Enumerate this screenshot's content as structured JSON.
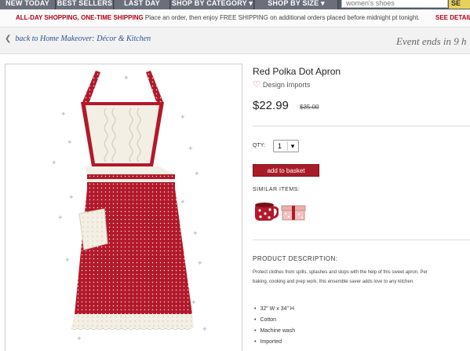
{
  "nav": {
    "tabs": [
      "NEW TODAY",
      "BEST SELLERS",
      "LAST DAY",
      "SHOP BY CATEGORY ▾",
      "SHOP BY SIZE ▾"
    ],
    "search_value": "women's shoes",
    "search_button": "SE"
  },
  "promo": {
    "lead": "ALL-DAY SHOPPING, ONE-TIME SHIPPING",
    "text": " Place an order, then enjoy FREE SHIPPING on additional orders placed before midnight pt tonight.",
    "details": "SEE DETAIL"
  },
  "breadcrumb": {
    "back_label": "back to Home Makeover: Décor & Kitchen",
    "event_text": "Event ends in 9 h"
  },
  "product": {
    "title": "Red Polka Dot Apron",
    "brand": "Design Imports",
    "price": "$22.99",
    "old_price": "$35.00",
    "qty_label": "QTY:",
    "qty_value": "1",
    "add_button": "add to basket",
    "similar_label": "SIMILAR ITEMS:",
    "similar_items": [
      "red-polka-dot-mug-icon",
      "pink-gift-box-icon"
    ],
    "description_label": "PRODUCT DESCRIPTION:",
    "description_line1": "Protect clothes from spills, splashes and slops with the help of this sweet apron. Per",
    "description_line2": "baking, cooking and prep work, this ensemble saver adds love to any kitchen.",
    "bullets": [
      "32\" W x 34\" H",
      "Cotton",
      "Machine wash",
      "Imported"
    ]
  },
  "colors": {
    "nav_bg": "#555a66",
    "accent_red": "#a81c28",
    "promo_red": "#b00017",
    "link_blue": "#2f4f8c"
  }
}
